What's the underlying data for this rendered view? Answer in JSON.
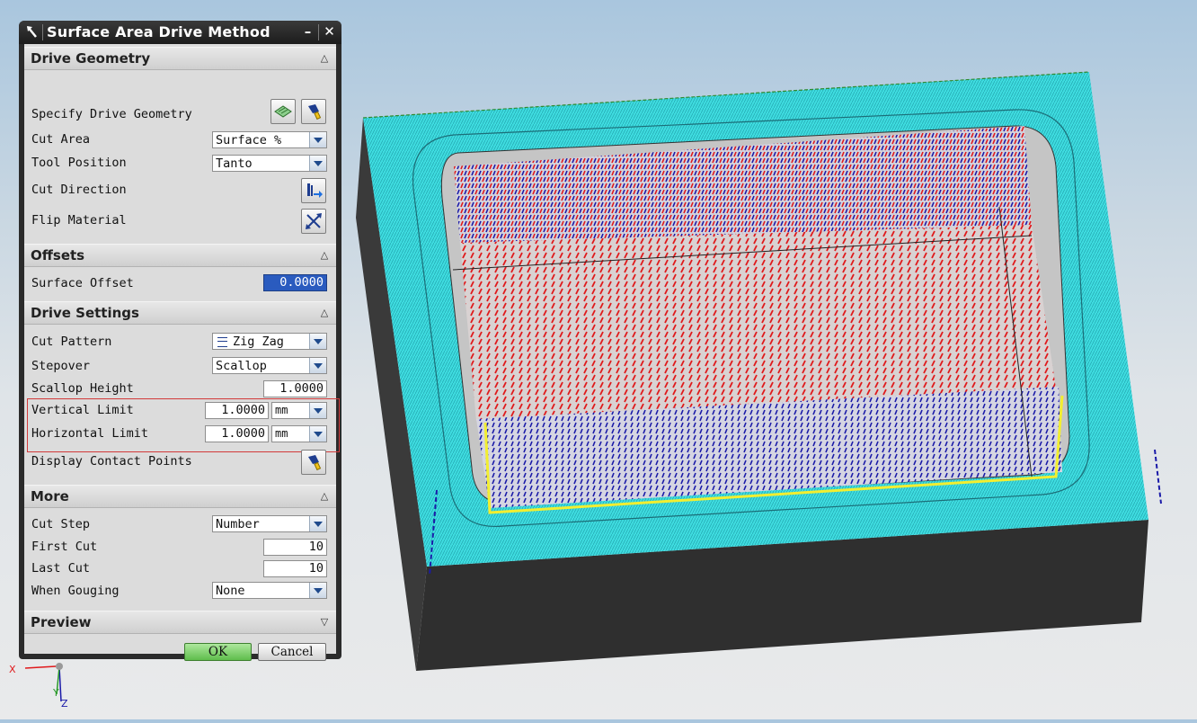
{
  "dialog": {
    "title": "Surface Area Drive Method",
    "minimize": "–",
    "close": "✕",
    "sections": {
      "drive_geometry": {
        "label": "Drive Geometry",
        "specify_drive_geometry": "Specify Drive Geometry",
        "cut_area": {
          "label": "Cut Area",
          "value": "Surface %"
        },
        "tool_position": {
          "label": "Tool Position",
          "value": "Tanto"
        },
        "cut_direction": "Cut Direction",
        "flip_material": "Flip Material"
      },
      "offsets": {
        "label": "Offsets",
        "surface_offset": {
          "label": "Surface Offset",
          "value": "0.0000"
        }
      },
      "drive_settings": {
        "label": "Drive Settings",
        "cut_pattern": {
          "label": "Cut Pattern",
          "value": "Zig Zag"
        },
        "stepover": {
          "label": "Stepover",
          "value": "Scallop"
        },
        "scallop_height": {
          "label": "Scallop Height",
          "value": "1.0000"
        },
        "vertical_limit": {
          "label": "Vertical Limit",
          "value": "1.0000",
          "unit": "mm"
        },
        "horizontal_limit": {
          "label": "Horizontal Limit",
          "value": "1.0000",
          "unit": "mm"
        },
        "display_contact_points": "Display Contact Points"
      },
      "more": {
        "label": "More",
        "cut_step": {
          "label": "Cut Step",
          "value": "Number"
        },
        "first_cut": {
          "label": "First Cut",
          "value": "10"
        },
        "last_cut": {
          "label": "Last Cut",
          "value": "10"
        },
        "when_gouging": {
          "label": "When Gouging",
          "value": "None"
        }
      },
      "preview": {
        "label": "Preview"
      }
    },
    "ok": "OK",
    "cancel": "Cancel"
  },
  "triad": {
    "x": "X",
    "y": "Y",
    "z": "Z"
  },
  "colors": {
    "part_top": "#3fdde0",
    "part_side": "#2e2e2e",
    "toolpath_red": "#e0191b",
    "toolpath_blue": "#1a1aa8",
    "contact_yellow": "#f2ee30",
    "ok_green": "#7ed36a",
    "highlight_frame": "#d23a3a"
  },
  "icons": [
    "specify-geometry-icon",
    "flashlight-icon",
    "cut-direction-icon",
    "flip-material-icon",
    "zigzag-pattern-icon",
    "dropdown-arrow-icon"
  ]
}
